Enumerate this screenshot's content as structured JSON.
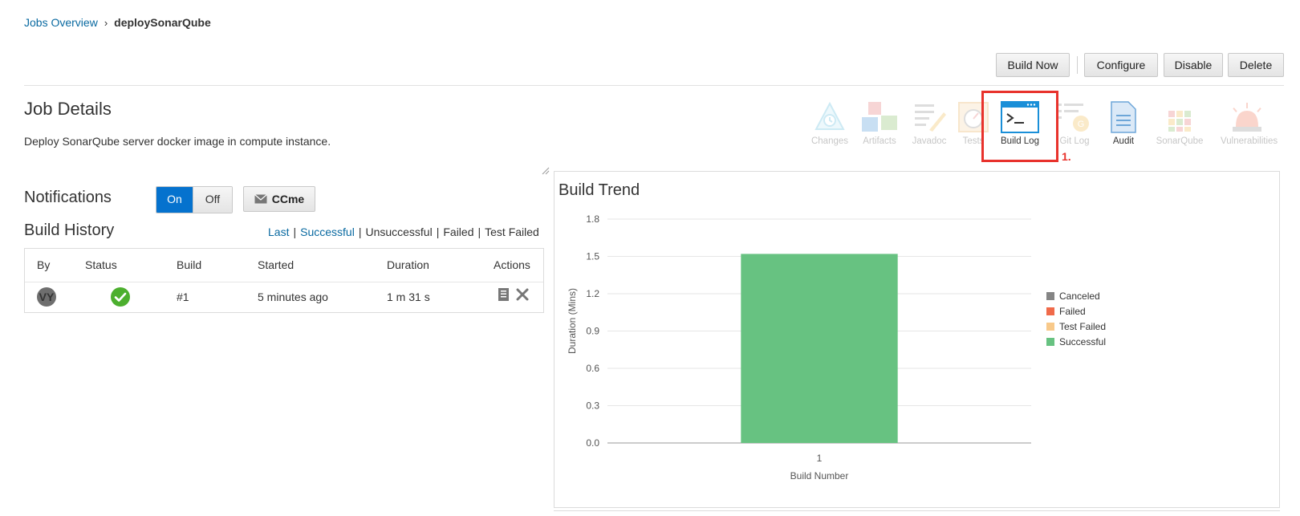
{
  "breadcrumb": {
    "parent": "Jobs Overview",
    "separator": "›",
    "current": "deploySonarQube"
  },
  "toolbar": {
    "build_now": "Build Now",
    "configure": "Configure",
    "disable": "Disable",
    "delete": "Delete"
  },
  "job": {
    "title": "Job Details",
    "description": "Deploy SonarQube server docker image in compute instance."
  },
  "tools": [
    {
      "label": "Changes",
      "icon": "changes-icon"
    },
    {
      "label": "Artifacts",
      "icon": "artifacts-icon"
    },
    {
      "label": "Javadoc",
      "icon": "javadoc-icon"
    },
    {
      "label": "Tests",
      "icon": "tests-icon"
    },
    {
      "label": "Build Log",
      "icon": "terminal-icon"
    },
    {
      "label": "Git Log",
      "icon": "git-log-icon"
    },
    {
      "label": "Audit",
      "icon": "audit-icon"
    },
    {
      "label": "SonarQube",
      "icon": "sonarqube-icon"
    },
    {
      "label": "Vulnerabilities",
      "icon": "vulnerabilities-icon"
    }
  ],
  "annotation": "1.",
  "notifications": {
    "label": "Notifications",
    "on": "On",
    "off": "Off",
    "ccme": "CCme"
  },
  "build_history": {
    "title": "Build History",
    "filters": [
      "Last",
      "Successful",
      "Unsuccessful",
      "Failed",
      "Test Failed"
    ],
    "columns": [
      "By",
      "Status",
      "Build",
      "Started",
      "Duration",
      "Actions"
    ],
    "rows": [
      {
        "by": "VY",
        "status": "success",
        "build": "#1",
        "started": "5 minutes ago",
        "duration": "1 m 31 s"
      }
    ]
  },
  "colors": {
    "accent": "#0572ce",
    "link": "#0a6aa1",
    "success": "#67c281",
    "failed": "#f06a4a",
    "test_failed": "#f8c98a",
    "canceled": "#858585",
    "highlight": "#e8322c"
  },
  "chart_data": {
    "type": "bar",
    "title": "Build Trend",
    "xlabel": "Build Number",
    "ylabel": "Duration (Mins)",
    "categories": [
      "1"
    ],
    "series": [
      {
        "name": "Successful",
        "values": [
          1.52
        ]
      }
    ],
    "ylim": [
      0,
      1.8
    ],
    "yticks": [
      "1.8",
      "1.5",
      "1.2",
      "0.9",
      "0.6",
      "0.3",
      "0.0"
    ],
    "legend": [
      "Canceled",
      "Failed",
      "Test Failed",
      "Successful"
    ],
    "legend_position": "right",
    "grid": true
  }
}
